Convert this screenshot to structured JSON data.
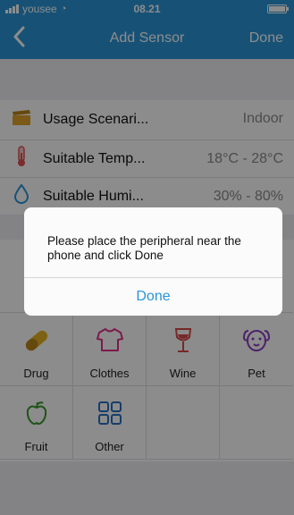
{
  "status_bar": {
    "carrier": "yousee",
    "time": "08.21"
  },
  "nav": {
    "title": "Add Sensor",
    "done_label": "Done",
    "back_icon": "chevron-left-icon"
  },
  "info": [
    {
      "icon": "clapperboard-icon",
      "label": "Usage Scenari...",
      "value": "Indoor"
    },
    {
      "icon": "thermometer-icon",
      "label": "Suitable Temp...",
      "value": "18°C - 28°C"
    },
    {
      "icon": "droplet-icon",
      "label": "Suitable Humi...",
      "value": "30% - 80%"
    }
  ],
  "categories": [
    {
      "icon": "pill-icon",
      "label": "Drug"
    },
    {
      "icon": "shirt-icon",
      "label": "Clothes"
    },
    {
      "icon": "wine-glass-icon",
      "label": "Wine"
    },
    {
      "icon": "dog-face-icon",
      "label": "Pet"
    },
    {
      "icon": "apple-icon",
      "label": "Fruit"
    },
    {
      "icon": "grid-icon",
      "label": "Other"
    }
  ],
  "dialog": {
    "message": "Please place the peripheral near the phone and click Done",
    "button_label": "Done"
  },
  "colors": {
    "accent": "#2a95d8"
  }
}
